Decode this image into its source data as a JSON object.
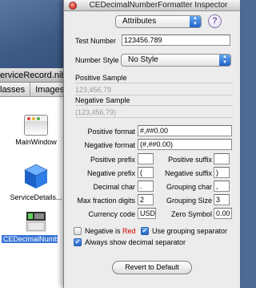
{
  "background_window": {
    "title": "erviceRecord.nib",
    "tabs": [
      "lasses",
      "Images"
    ],
    "items": [
      {
        "label": "MainWindow"
      },
      {
        "label": "ServiceDetails..."
      },
      {
        "label": "CEDecimalNumber..."
      }
    ]
  },
  "inspector": {
    "title": "CEDecimalNumberFormatter Inspector",
    "pane_popup": "Attributes",
    "help_label": "?",
    "test_number_label": "Test Number",
    "test_number_value": "123456.789",
    "number_style_label": "Number Style",
    "number_style_value": "No Style",
    "positive_sample_label": "Positive Sample",
    "positive_sample_value": "123,456.79",
    "negative_sample_label": "Negative Sample",
    "negative_sample_value": "(123,456.79)",
    "positive_format_label": "Positive format",
    "positive_format_value": "#,##0.00",
    "negative_format_label": "Negative format",
    "negative_format_value": "(#,##0.00)",
    "positive_prefix_label": "Positive prefix",
    "positive_prefix_value": "",
    "positive_suffix_label": "Positive suffix",
    "positive_suffix_value": "",
    "negative_prefix_label": "Negative prefix",
    "negative_prefix_value": "(",
    "negative_suffix_label": "Negative suffix",
    "negative_suffix_value": ")",
    "decimal_char_label": "Decimal char",
    "decimal_char_value": ".",
    "grouping_char_label": "Grouping char",
    "grouping_char_value": ",",
    "max_fraction_label": "Max fraction digits",
    "max_fraction_value": "2",
    "grouping_size_label": "Grouping Size",
    "grouping_size_value": "3",
    "currency_code_label": "Currency code",
    "currency_code_value": "USD",
    "zero_symbol_label": "Zero Symbol",
    "zero_symbol_value": "0.00",
    "negative_red_prefix": "Negative is ",
    "negative_red_word": "Red",
    "negative_red_checked": false,
    "use_grouping_label": "Use grouping separator",
    "use_grouping_checked": true,
    "always_decimal_label": "Always show decimal separator",
    "always_decimal_checked": true,
    "revert_button": "Revert to Default"
  },
  "colors": {
    "desktop": "#4d6a94",
    "selection": "#3875d7",
    "accent_blue": "#1f63c8",
    "red_text": "#d00000"
  },
  "icons": [
    "window-icon",
    "cube-icon",
    "formatter-icon",
    "close-icon",
    "help-icon",
    "popup-arrows-icon",
    "checkmark-icon"
  ]
}
